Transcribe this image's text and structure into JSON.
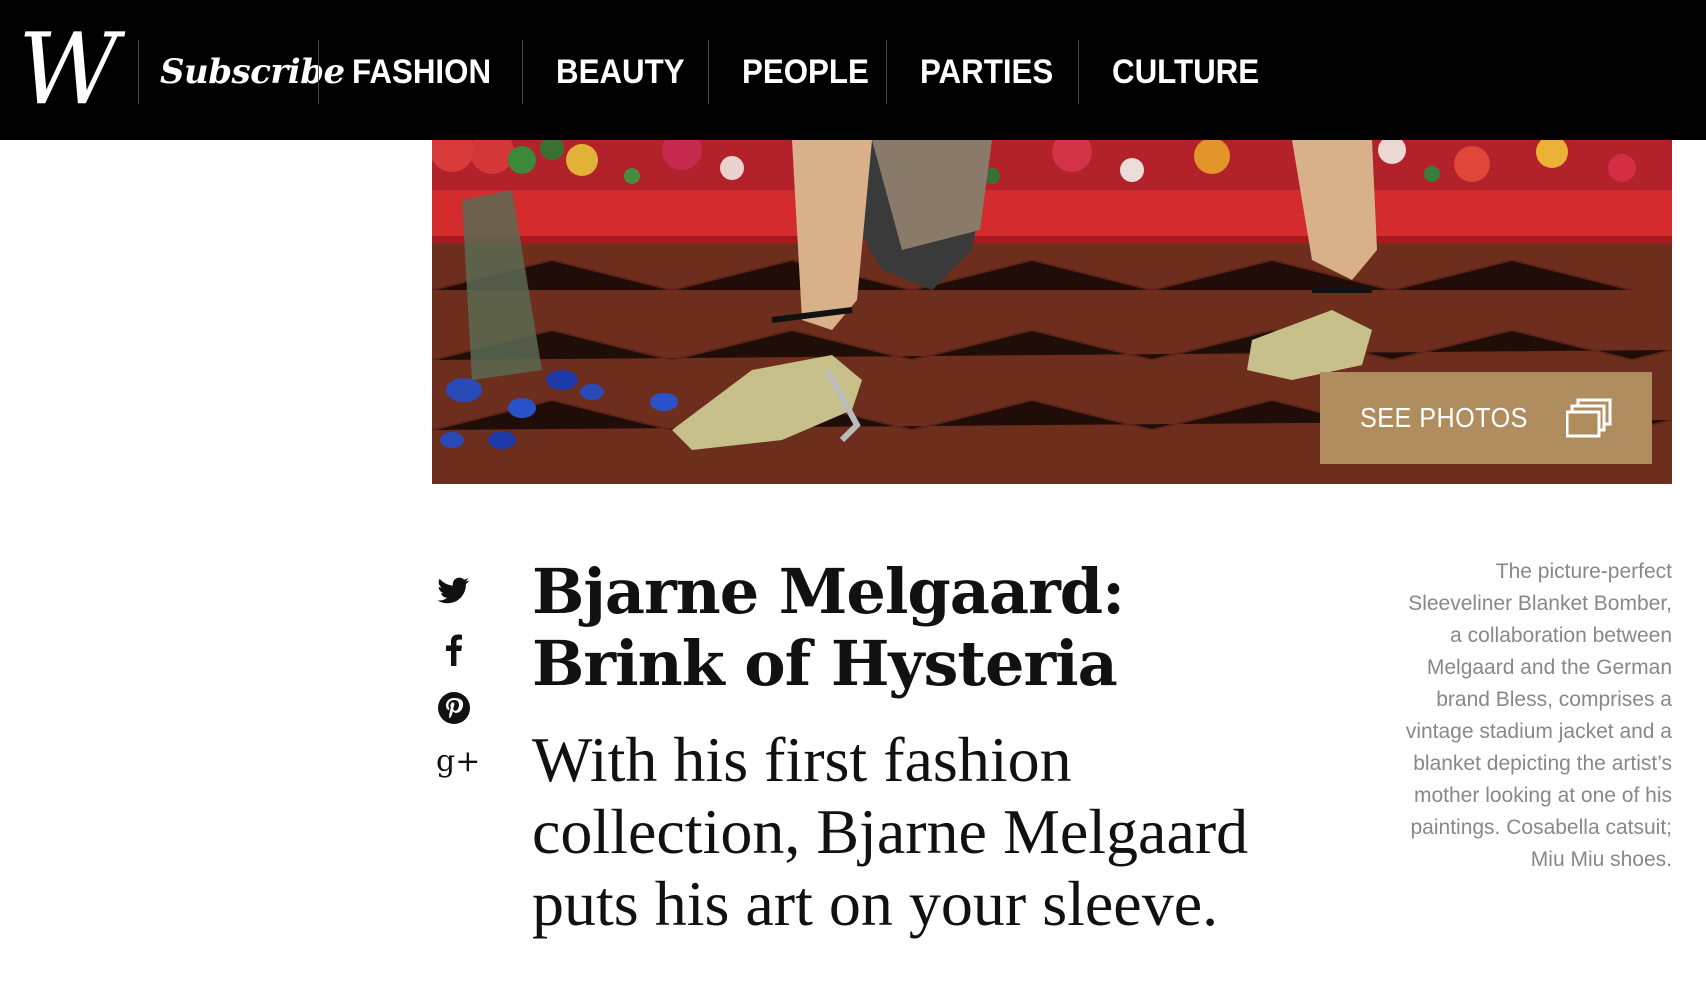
{
  "nav": {
    "logo": "W",
    "subscribe": "Subscribe",
    "sections": [
      "FASHION",
      "BEAUTY",
      "PEOPLE",
      "PARTIES",
      "CULTURE"
    ]
  },
  "hero": {
    "see_photos_label": "SEE PHOTOS",
    "accent_color": "#b08d5e"
  },
  "share": {
    "icons": [
      "twitter-icon",
      "facebook-icon",
      "pinterest-icon",
      "google-plus-icon"
    ],
    "google_plus_glyph": "g+"
  },
  "article": {
    "headline": "Bjarne Melgaard: Brink of Hysteria",
    "dek": "With his first fashion collection, Bjarne Melgaard puts his art on your sleeve.",
    "caption": "The picture-perfect Sleeveliner Blanket Bomber, a collaboration between Melgaard and the German brand Bless, comprises a vintage stadium jacket and a blanket depicting the artist’s mother looking at one of his paintings. Cosabella catsuit; Miu Miu shoes."
  }
}
